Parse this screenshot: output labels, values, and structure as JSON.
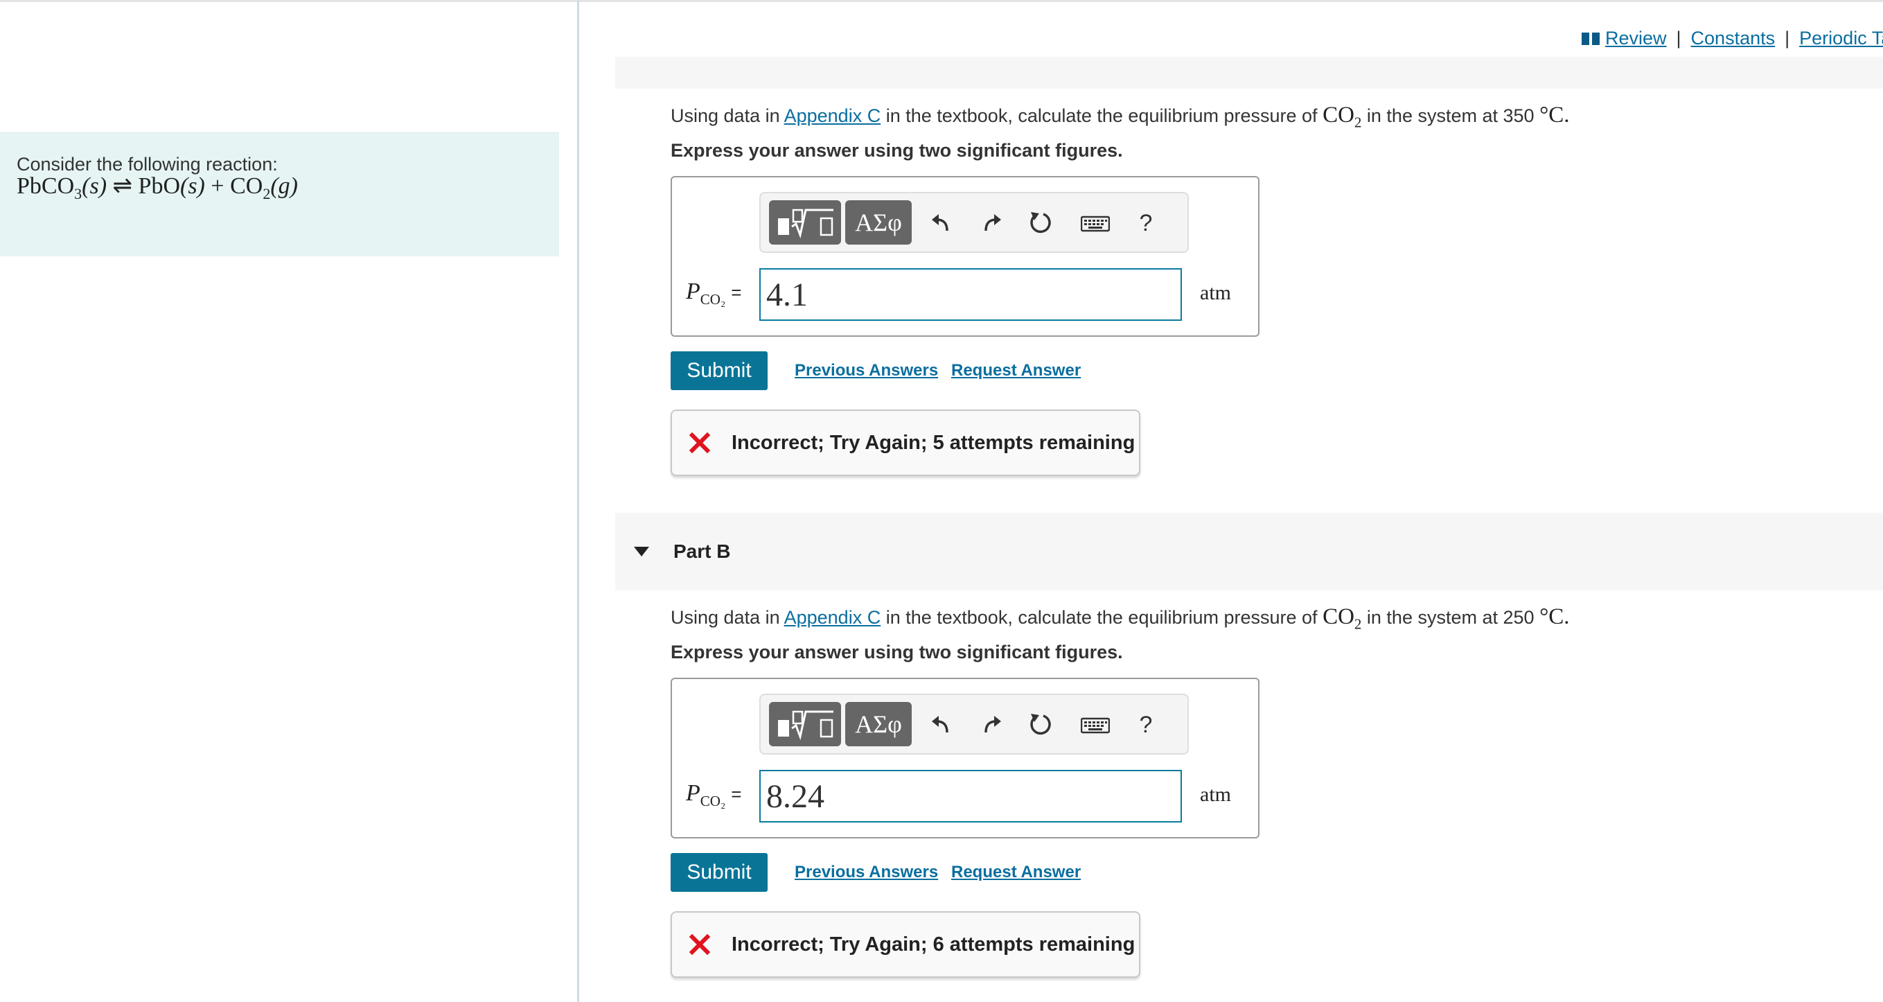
{
  "left_panel": {
    "intro_text": "Consider the following reaction:",
    "reaction": {
      "reactant": "PbCO",
      "reactant_sub": "3",
      "reactant_state": "(s)",
      "arrow": "⇌",
      "product1": "PbO",
      "product1_state": "(s)",
      "plus": "+",
      "product2": "CO",
      "product2_sub": "2",
      "product2_state": "(g)"
    }
  },
  "header_links": {
    "review": "Review",
    "constants": "Constants",
    "periodic": "Periodic Ta",
    "separator": "|"
  },
  "parts": [
    {
      "prompt_pre": "Using data in ",
      "appendix_link": "Appendix C",
      "prompt_mid": " in the textbook, calculate the equilibrium pressure of ",
      "species": "CO",
      "species_sub": "2",
      "prompt_post": " in the system at ",
      "temperature": "350",
      "temp_unit": "°C.",
      "instruction": "Express your answer using two significant figures.",
      "variable": "P",
      "variable_sub": "CO₂",
      "equals": "=",
      "answer_value": "4.1",
      "unit": "atm",
      "submit_label": "Submit",
      "previous_answers": "Previous Answers",
      "request_answer": "Request Answer",
      "feedback": "Incorrect; Try Again; 5 attempts remaining"
    },
    {
      "title": "Part B",
      "prompt_pre": "Using data in ",
      "appendix_link": "Appendix C",
      "prompt_mid": " in the textbook, calculate the equilibrium pressure of ",
      "species": "CO",
      "species_sub": "2",
      "prompt_post": " in the system at ",
      "temperature": "250",
      "temp_unit": "°C.",
      "instruction": "Express your answer using two significant figures.",
      "variable": "P",
      "variable_sub": "CO₂",
      "equals": "=",
      "answer_value": "8.24",
      "unit": "atm",
      "submit_label": "Submit",
      "previous_answers": "Previous Answers",
      "request_answer": "Request Answer",
      "feedback": "Incorrect; Try Again; 6 attempts remaining"
    }
  ],
  "toolbar": {
    "greek_label": "ΑΣφ",
    "help_label": "?",
    "icons": [
      "templates-icon",
      "greek-symbols-icon",
      "undo-icon",
      "redo-icon",
      "reset-icon",
      "keyboard-icon",
      "help-icon"
    ]
  },
  "colors": {
    "accent": "#0a7497",
    "link": "#0a6e9f",
    "intro_bg": "#e6f4f4",
    "error": "#e0141e",
    "toolbar_button": "#666666"
  }
}
